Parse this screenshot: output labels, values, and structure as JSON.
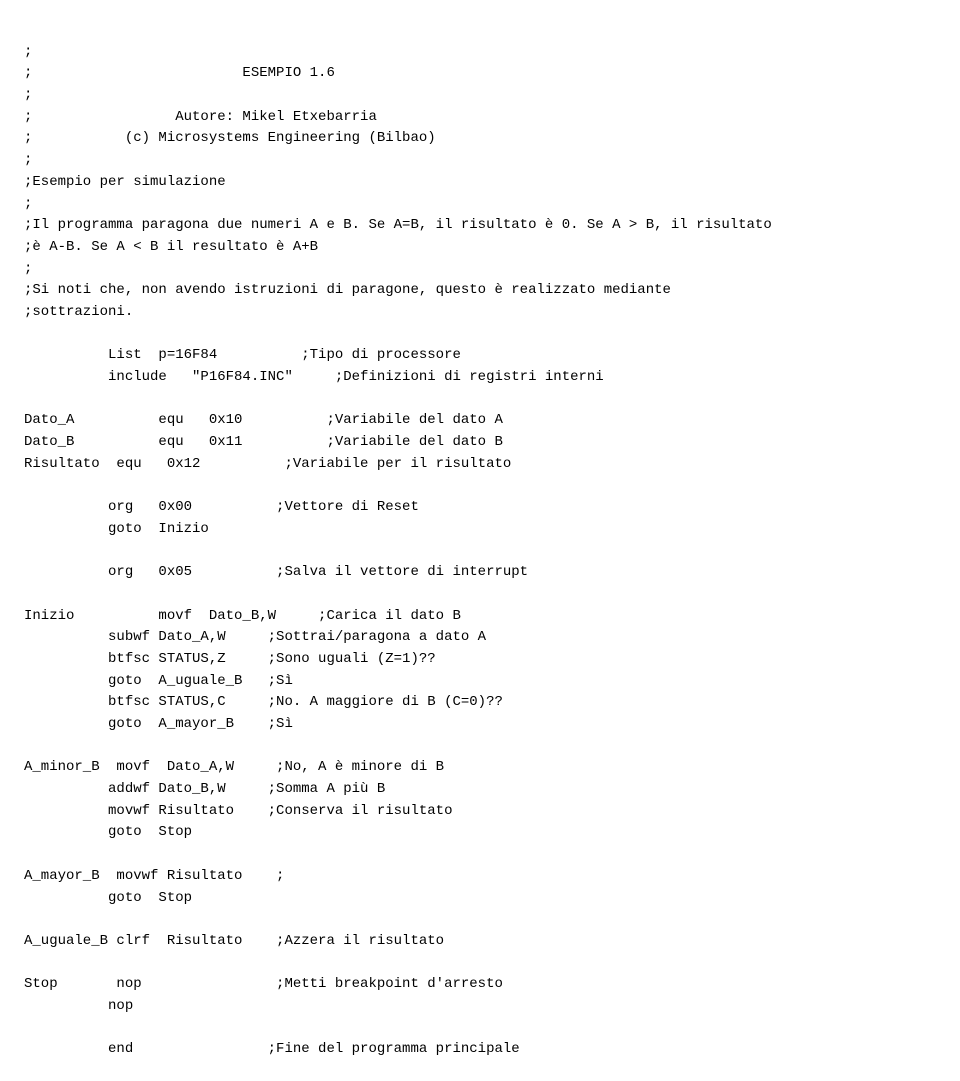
{
  "code": {
    "lines": [
      ";",
      ";                         ESEMPIO 1.6",
      ";",
      ";                 Autore: Mikel Etxebarria",
      ";           (c) Microsystems Engineering (Bilbao)",
      ";",
      ";Esempio per simulazione",
      ";",
      ";Il programma paragona due numeri A e B. Se A=B, il risultato è 0. Se A > B, il risultato",
      ";è A-B. Se A < B il resultato è A+B",
      ";",
      ";Si noti che, non avendo istruzioni di paragone, questo è realizzato mediante",
      ";sottrazioni.",
      "",
      "          List  p=16F84          ;Tipo di processore",
      "          include   \"P16F84.INC\"     ;Definizioni di registri interni",
      "",
      "Dato_A          equ   0x10          ;Variabile del dato A",
      "Dato_B          equ   0x11          ;Variabile del dato B",
      "Risultato  equ   0x12          ;Variabile per il risultato",
      "",
      "          org   0x00          ;Vettore di Reset",
      "          goto  Inizio",
      "",
      "          org   0x05          ;Salva il vettore di interrupt",
      "",
      "Inizio          movf  Dato_B,W     ;Carica il dato B",
      "          subwf Dato_A,W     ;Sottrai/paragona a dato A",
      "          btfsc STATUS,Z     ;Sono uguali (Z=1)??",
      "          goto  A_uguale_B   ;Sì",
      "          btfsc STATUS,C     ;No. A maggiore di B (C=0)??",
      "          goto  A_mayor_B    ;Sì",
      "",
      "A_minor_B  movf  Dato_A,W     ;No, A è minore di B",
      "          addwf Dato_B,W     ;Somma A più B",
      "          movwf Risultato    ;Conserva il risultato",
      "          goto  Stop",
      "",
      "A_mayor_B  movwf Risultato    ;",
      "          goto  Stop",
      "",
      "A_uguale_B clrf  Risultato    ;Azzera il risultato",
      "",
      "Stop       nop                ;Metti breakpoint d'arresto",
      "          nop",
      "",
      "          end                ;Fine del programma principale"
    ]
  }
}
